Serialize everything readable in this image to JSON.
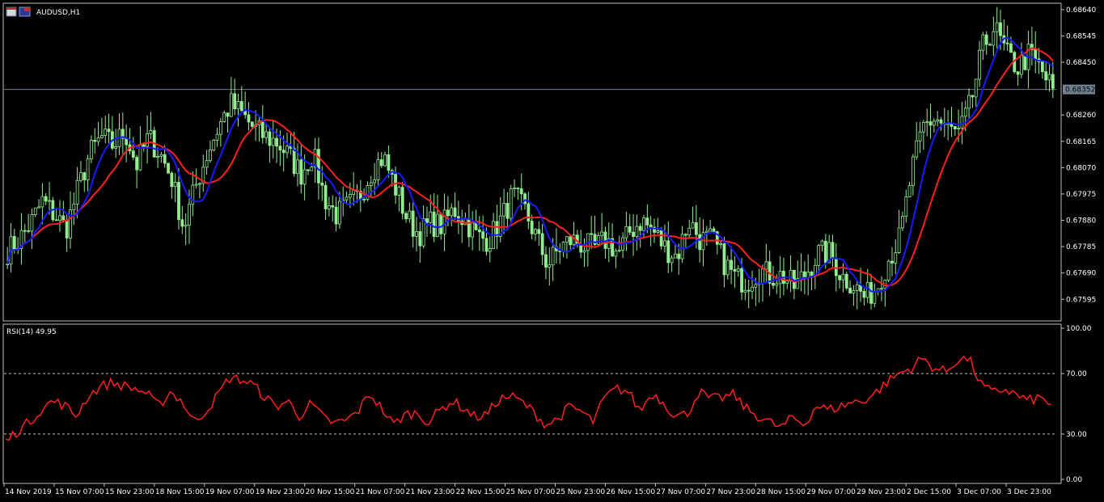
{
  "window": {
    "symbol_title": "AUDUSD,H1",
    "rsi_title": "RSI(14) 49.95"
  },
  "colors": {
    "background": "#000000",
    "candle": "#90EE90",
    "ma_fast": "#1a1aff",
    "ma_slow": "#ff2020",
    "rsi_line": "#ff2020",
    "bid_line": "#708090",
    "frame": "#c0c0c0",
    "price_tag_bg": "#708090"
  },
  "chart_data": [
    {
      "type": "candlestick",
      "name": "AUDUSD,H1",
      "ylim": [
        0.6752,
        0.6866
      ],
      "y_ticks": [
        "0.68640",
        "0.68545",
        "0.68450",
        "0.68352",
        "0.68260",
        "0.68165",
        "0.68070",
        "0.67975",
        "0.67880",
        "0.67785",
        "0.67690",
        "0.67595"
      ],
      "current_price": "0.68352",
      "x_labels": [
        "14 Nov 2019",
        "15 Nov 07:00",
        "15 Nov 23:00",
        "18 Nov 15:00",
        "19 Nov 07:00",
        "19 Nov 23:00",
        "20 Nov 15:00",
        "21 Nov 07:00",
        "21 Nov 23:00",
        "22 Nov 15:00",
        "25 Nov 07:00",
        "25 Nov 23:00",
        "26 Nov 15:00",
        "27 Nov 07:00",
        "27 Nov 23:00",
        "28 Nov 15:00",
        "29 Nov 07:00",
        "29 Nov 23:00",
        "2 Dec 15:00",
        "3 Dec 07:00",
        "3 Dec 23:00"
      ],
      "price_path": [
        0.6777,
        0.6781,
        0.6787,
        0.6795,
        0.679,
        0.6785,
        0.6799,
        0.6812,
        0.6818,
        0.6815,
        0.682,
        0.6808,
        0.6818,
        0.6812,
        0.6803,
        0.6785,
        0.68,
        0.6812,
        0.6822,
        0.683,
        0.6826,
        0.6821,
        0.6818,
        0.6816,
        0.6811,
        0.6805,
        0.6812,
        0.6796,
        0.679,
        0.6793,
        0.6797,
        0.6806,
        0.6811,
        0.68,
        0.6789,
        0.6783,
        0.6787,
        0.6786,
        0.6792,
        0.6788,
        0.6782,
        0.6781,
        0.6788,
        0.6797,
        0.6792,
        0.6782,
        0.6772,
        0.6778,
        0.6781,
        0.6779,
        0.6778,
        0.6781,
        0.6776,
        0.6784,
        0.6788,
        0.6784,
        0.6778,
        0.6775,
        0.6788,
        0.6781,
        0.6781,
        0.6773,
        0.6767,
        0.6766,
        0.677,
        0.6768,
        0.6768,
        0.6764,
        0.6769,
        0.6776,
        0.6776,
        0.6768,
        0.6765,
        0.676,
        0.6764,
        0.6774,
        0.6782,
        0.6806,
        0.6822,
        0.6825,
        0.6821,
        0.6819,
        0.683,
        0.685,
        0.6858,
        0.6848,
        0.6843,
        0.6848,
        0.6842,
        0.6835
      ]
    },
    {
      "type": "line",
      "name": "RSI(14)",
      "value": 49.95,
      "ylim": [
        0,
        100
      ],
      "levels": [
        30,
        70
      ],
      "y_ticks": [
        "100.00",
        "70.00",
        "30.00",
        "0.00"
      ],
      "values": [
        25,
        32,
        38,
        46,
        52,
        49,
        42,
        55,
        61,
        64,
        62,
        60,
        57,
        48,
        58,
        52,
        38,
        45,
        55,
        67,
        66,
        63,
        55,
        48,
        52,
        42,
        50,
        41,
        37,
        39,
        45,
        57,
        47,
        36,
        43,
        44,
        38,
        46,
        52,
        47,
        41,
        43,
        53,
        55,
        51,
        44,
        36,
        40,
        48,
        45,
        38,
        54,
        60,
        58,
        45,
        57,
        51,
        42,
        43,
        58,
        53,
        54,
        56,
        47,
        42,
        38,
        34,
        41,
        36,
        49,
        46,
        48,
        51,
        52,
        57,
        64,
        70,
        73,
        80,
        74,
        71,
        79,
        80,
        63,
        57,
        60,
        56,
        52,
        54,
        50
      ]
    }
  ]
}
